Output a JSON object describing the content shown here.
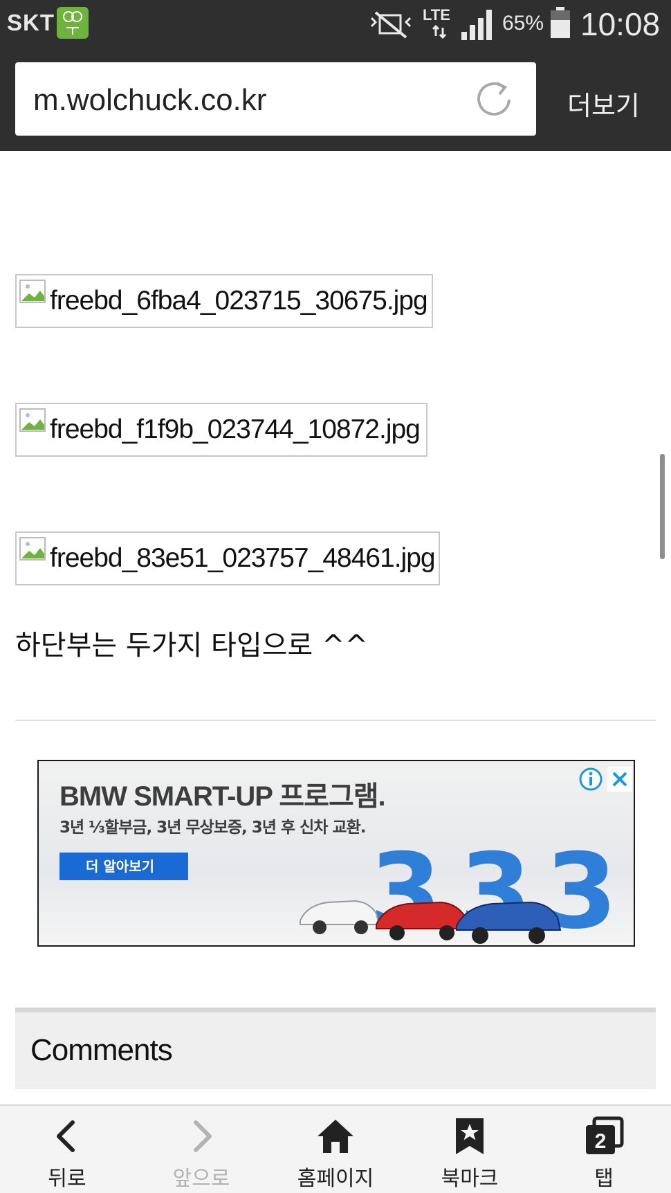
{
  "status_bar": {
    "carrier": "SKT",
    "app_badge_icon": "looting-app-icon",
    "network": "LTE",
    "battery_percent": "65%",
    "battery_level": 0.65,
    "time": "10:08"
  },
  "browser": {
    "url": "m.wolchuck.co.kr",
    "more_label": "더보기"
  },
  "content": {
    "images": [
      {
        "filename": "freebd_6fba4_023715_30675.jpg"
      },
      {
        "filename": "freebd_f1f9b_023744_10872.jpg"
      },
      {
        "filename": "freebd_83e51_023757_48461.jpg"
      }
    ],
    "body_text": "하단부는 두가지 타입으로 ^^",
    "comments_title": "Comments"
  },
  "ad": {
    "title": "BMW SMART-UP 프로그램.",
    "subtitle": "3년 ⅓할부금, 3년 무상보증, 3년 후 신차 교환.",
    "cta": "더 알아보기",
    "colors": {
      "cta": "#1a6ad6",
      "numerals": "#2f7ed8"
    }
  },
  "bottom_nav": {
    "items": [
      {
        "label": "뒤로",
        "icon": "back-icon",
        "enabled": true
      },
      {
        "label": "앞으로",
        "icon": "forward-icon",
        "enabled": false
      },
      {
        "label": "홈페이지",
        "icon": "home-icon",
        "enabled": true
      },
      {
        "label": "북마크",
        "icon": "bookmark-icon",
        "enabled": true
      },
      {
        "label": "탭",
        "icon": "tabs-icon",
        "enabled": true,
        "count": "2"
      }
    ]
  }
}
